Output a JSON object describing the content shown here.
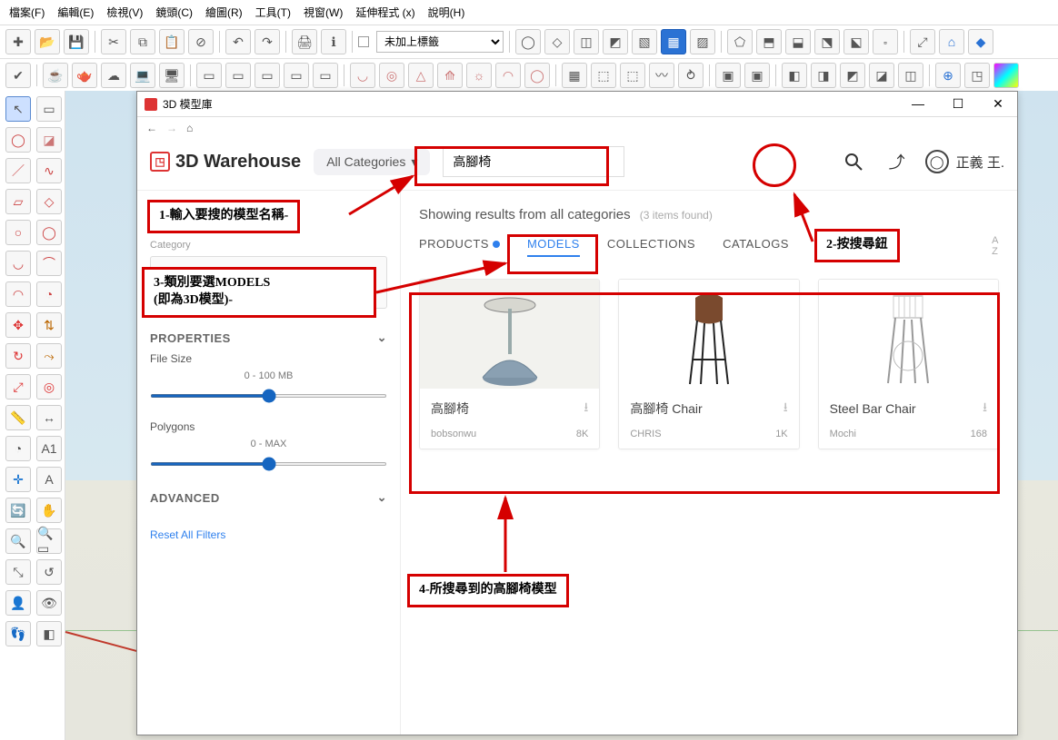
{
  "menu": {
    "file": "檔案(F)",
    "edit": "編輯(E)",
    "view": "檢視(V)",
    "camera": "鏡頭(C)",
    "draw": "繪圖(R)",
    "tools": "工具(T)",
    "window": "視窗(W)",
    "ext": "延伸程式 (x)",
    "help": "說明(H)"
  },
  "tagSelect": "未加上標籤",
  "window": {
    "title": "3D 模型庫",
    "min": "—",
    "max": "☐",
    "close": "✕"
  },
  "nav": {
    "back": "←",
    "fwd": "→",
    "home": "⌂"
  },
  "header": {
    "brand": "3D Warehouse",
    "category": "All Categories",
    "searchValue": "高腳椅",
    "upload": "⤴",
    "user": "正義 王."
  },
  "sidebar": {
    "categoryLabel": "Category",
    "properties": "PROPERTIES",
    "filesize": "File Size",
    "filesizeRange": "0 - 100 MB",
    "polygons": "Polygons",
    "polygonsRange": "0 - MAX",
    "advanced": "ADVANCED",
    "reset": "Reset All Filters"
  },
  "main": {
    "resultsText": "Showing results from all categories",
    "resultsCount": "(3 items found)",
    "tabs": {
      "products": "PRODUCTS",
      "models": "MODELS",
      "collections": "COLLECTIONS",
      "catalogs": "CATALOGS"
    },
    "sort": "A\nZ"
  },
  "cards": [
    {
      "title": "高腳椅",
      "author": "bobsonwu",
      "count": "8K"
    },
    {
      "title": "高腳椅 Chair",
      "author": "CHRIS",
      "count": "1K"
    },
    {
      "title": "Steel Bar Chair",
      "author": "Mochi",
      "count": "168"
    }
  ],
  "ann": {
    "a1": "1-輸入要搜的模型名稱-",
    "a2": "2-按搜尋鈕",
    "a3a": "3-類別要選MODELS",
    "a3b": "(即為3D模型)-",
    "a4": "4-所搜尋到的高腳椅模型"
  }
}
